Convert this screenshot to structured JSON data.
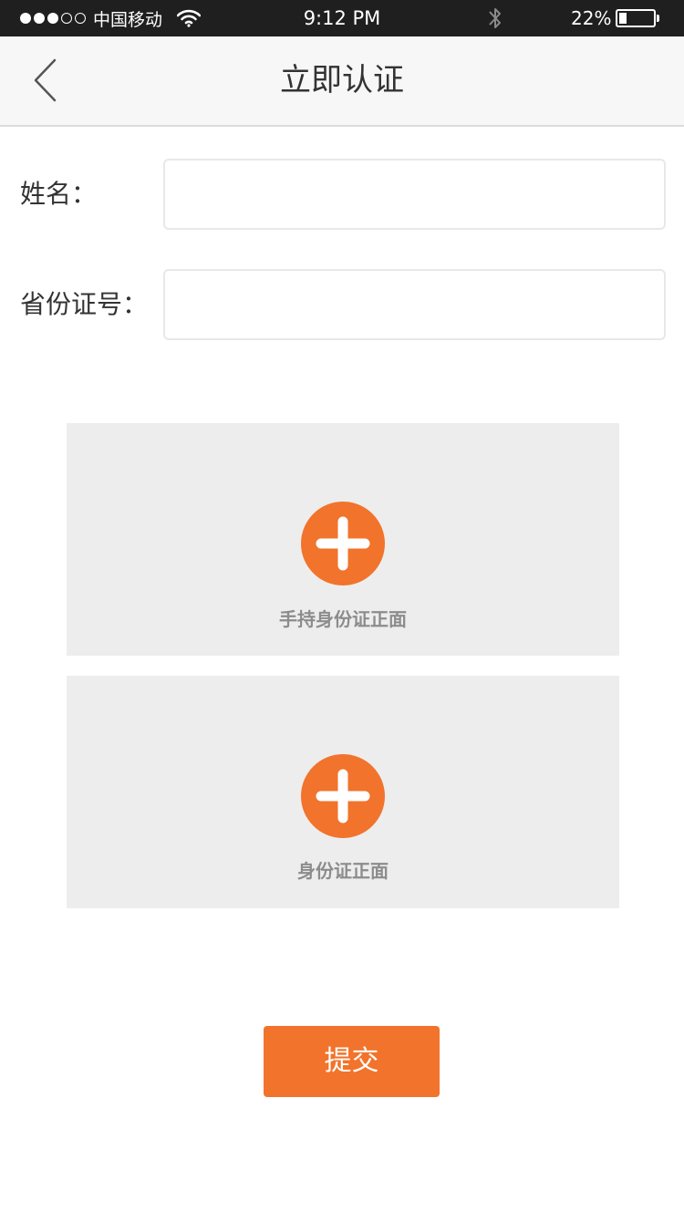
{
  "status_bar": {
    "carrier": "中国移动",
    "time": "9:12 PM",
    "battery_percent": "22%",
    "battery_level": 0.22,
    "signal_icon": "signal-dots-icon",
    "wifi_icon": "wifi-icon",
    "bluetooth_icon": "bluetooth-icon",
    "battery_icon": "battery-icon"
  },
  "nav": {
    "title": "立即认证",
    "back_icon": "chevron-left-icon"
  },
  "form": {
    "name_label": "姓名：",
    "name_value": "",
    "id_label": "省份证号：",
    "id_value": ""
  },
  "uploads": [
    {
      "label": "手持身份证正面",
      "icon": "plus-circle-icon"
    },
    {
      "label": "身份证正面",
      "icon": "plus-circle-icon"
    }
  ],
  "submit_label": "提交",
  "colors": {
    "accent": "#f2732b",
    "status_bar": "#1f1f1f",
    "nav_bg": "#f7f7f7",
    "tile_bg": "#ededed"
  }
}
